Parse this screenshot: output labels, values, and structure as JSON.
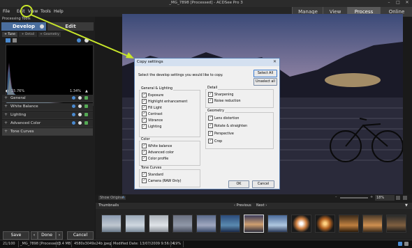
{
  "window": {
    "title": "_MG_7898 [Processed] - ACDSee Pro 3"
  },
  "menu": [
    "File",
    "Edit",
    "View",
    "Tools",
    "Help"
  ],
  "modes": [
    "Manage",
    "View",
    "Process",
    "Online"
  ],
  "active_mode": "Process",
  "left_panel": {
    "label": "Processing Tools",
    "develop_tab": "Develop",
    "edit_tab": "Edit",
    "subtabs": [
      "Tune",
      "Detail",
      "Geometry"
    ],
    "stats": {
      "left": "15.76%",
      "right": "1.34%"
    },
    "sections": [
      "General",
      "White Balance",
      "Lighting",
      "Advanced Color",
      "Tone Curves"
    ],
    "buttons": {
      "save": "Save",
      "done": "Done",
      "cancel": "Cancel"
    }
  },
  "dialog": {
    "title": "Copy settings",
    "instruction": "Select the develop settings you would like to copy.",
    "select_all": "Select All",
    "unselect_all": "Unselect all",
    "groups": {
      "general": {
        "title": "General & Lighting",
        "items": [
          "Exposure",
          "Highlight enhancement",
          "Fill Light",
          "Contrast",
          "Vibrance",
          "Lighting"
        ]
      },
      "color": {
        "title": "Color",
        "items": [
          "White balance",
          "Advanced color",
          "Color profile"
        ]
      },
      "tone": {
        "title": "Tone Curves",
        "items": [
          "Standard",
          "Camera (RAW Only)"
        ]
      },
      "detail": {
        "title": "Detail",
        "items": [
          "Sharpening",
          "Noise reduction"
        ]
      },
      "geometry": {
        "title": "Geometry",
        "items": [
          "Lens distortion",
          "Rotate & straighten",
          "Perspective",
          "Crop"
        ]
      }
    },
    "ok": "OK",
    "cancel": "Cancel"
  },
  "preview": {
    "show_original": "Show Original",
    "zoom": "18%"
  },
  "thumbnails": {
    "label": "Thumbnails",
    "previous": "Previous",
    "next": "Next"
  },
  "status": {
    "index": "21/100",
    "filename": "_MG_7898 [Processed]",
    "size": "3.4 MB",
    "dims": "4580x3049x24b jpeg",
    "modified": "Modified Date: 13/07/2009 9:56:04",
    "zoom": "19%"
  },
  "colors": {
    "accent": "#4a6e9e",
    "arrow": "#c8e62a"
  }
}
